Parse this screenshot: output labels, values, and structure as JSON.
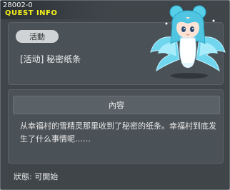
{
  "window": {
    "quest_id": "28002-0",
    "title": "QUEST INFO"
  },
  "quest": {
    "category": "活動",
    "name": "[活动] 秘密纸条"
  },
  "content": {
    "header": "內容",
    "description": "从幸福村的雪精灵那里收到了秘密的纸条。幸福村到底发生了什么事情呢……"
  },
  "status": {
    "text": "狀態: 可開始"
  },
  "colors": {
    "title": "#f7f01b",
    "background": "#3f4549",
    "panel": "#4b5257"
  },
  "icons": {
    "character": "snow-spirit-avatar"
  }
}
